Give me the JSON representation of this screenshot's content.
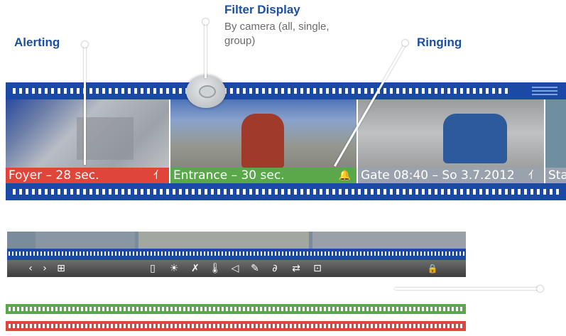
{
  "callouts": {
    "filter": {
      "title": "Filter Display",
      "subtitle_line1": "By camera (all, single,",
      "subtitle_line2": "group)"
    },
    "alerting": {
      "title": "Alerting"
    },
    "ringing": {
      "title": "Ringing"
    }
  },
  "frames": [
    {
      "caption": "Foyer – 28 sec.",
      "icon": "activity-icon",
      "icon_glyph": "⺅",
      "color": "#e0453a"
    },
    {
      "caption": "Entrance – 30 sec.",
      "icon": "bell-icon",
      "icon_glyph": "🔔",
      "color": "#5aa84a"
    },
    {
      "caption": "Gate 08:40 – So 3.7.2012",
      "icon": "activity-icon",
      "icon_glyph": "⺅",
      "color": "#9aa3ad"
    },
    {
      "caption": "Sta",
      "color": "#9aa3ad"
    }
  ],
  "toolbar": {
    "prev": "‹",
    "next": "›",
    "layout": "⊞",
    "door": "▯",
    "light": "☀",
    "mute": "✗",
    "temp": "🌡",
    "speaker": "◁",
    "mic": "✎",
    "link": "∂",
    "switch": "⇄",
    "camera": "⊡",
    "lock": "🔒"
  },
  "colors": {
    "blue": "#1a4aa6",
    "green": "#5aa84a",
    "red": "#e0453a"
  }
}
